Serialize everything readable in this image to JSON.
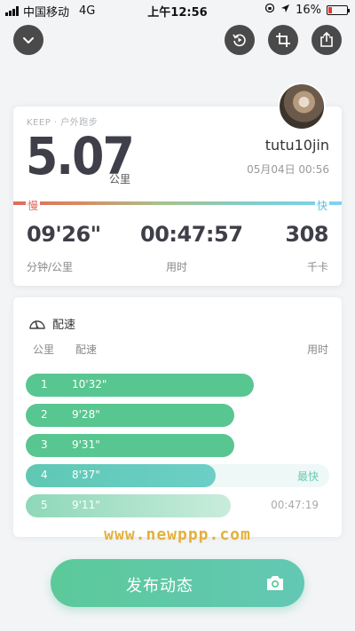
{
  "status_bar": {
    "carrier": "中国移动",
    "network": "4G",
    "time": "上午12:56",
    "battery": "16%"
  },
  "toolbar": {
    "icons": [
      "chevron-down-icon",
      "replay-icon",
      "crop-icon",
      "share-icon"
    ]
  },
  "summary": {
    "brand": "KEEP · 户外跑步",
    "distance": "5.07",
    "distance_unit": "公里",
    "username": "tutu10jin",
    "date": "05月04日 00:56",
    "slow_label": "慢",
    "fast_label": "快",
    "stats": [
      {
        "value": "09'26\"",
        "label": "分钟/公里"
      },
      {
        "value": "00:47:57",
        "label": "用时"
      },
      {
        "value": "308",
        "label": "千卡"
      }
    ]
  },
  "pace": {
    "title": "配速",
    "columns": {
      "km": "公里",
      "pace": "配速",
      "time": "用时"
    },
    "rows": [
      {
        "km": "1",
        "pace": "10'32\"",
        "extra": "",
        "fill": 0.6
      },
      {
        "km": "2",
        "pace": "9'28\"",
        "extra": "",
        "fill": 0.55
      },
      {
        "km": "3",
        "pace": "9'31\"",
        "extra": "",
        "fill": 0.55
      },
      {
        "km": "4",
        "pace": "8'37\"",
        "extra": "最快",
        "fill": 0.5
      },
      {
        "km": "5",
        "pace": "9'11\"",
        "extra": "00:47:19",
        "fill": 0.54
      }
    ]
  },
  "watermark": "www.newppp.com",
  "publish": {
    "label": "发布动态"
  },
  "colors": {
    "accent": "#5cc99a",
    "slow": "#e06a5d",
    "fast": "#7dd3ee",
    "watermark": "#e2b13c"
  }
}
